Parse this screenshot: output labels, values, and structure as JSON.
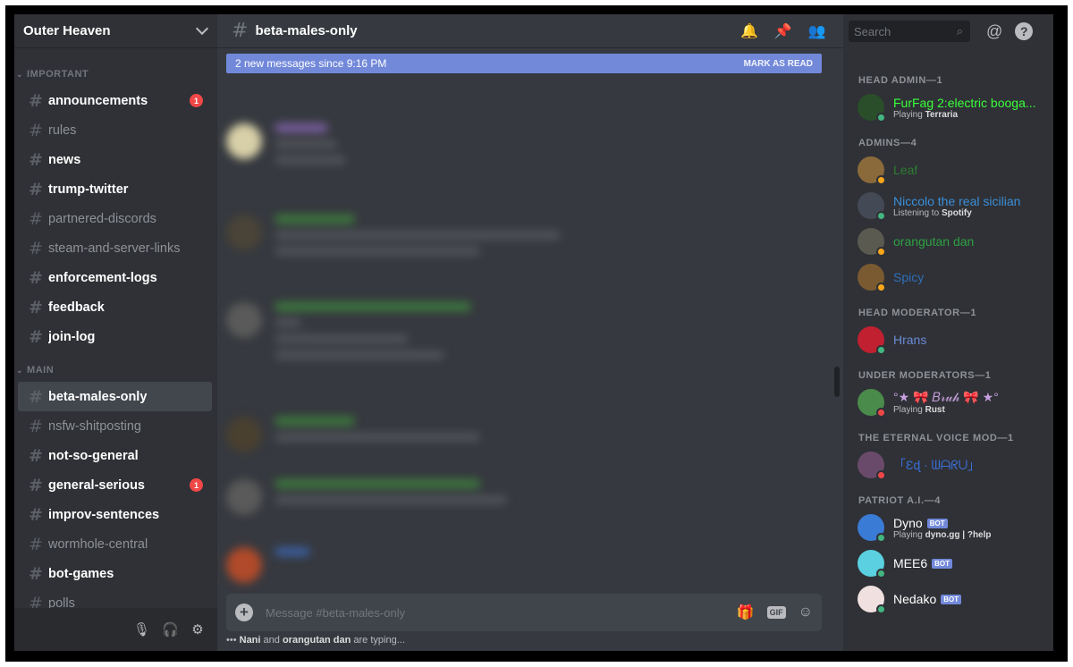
{
  "server": {
    "name": "Outer Heaven"
  },
  "categories": [
    {
      "name": "IMPORTANT",
      "channels": [
        {
          "name": "announcements",
          "state": "unread",
          "badge": "1"
        },
        {
          "name": "rules",
          "state": "muted"
        },
        {
          "name": "news",
          "state": "unread"
        },
        {
          "name": "trump-twitter",
          "state": "unread"
        },
        {
          "name": "partnered-discords",
          "state": "muted"
        },
        {
          "name": "steam-and-server-links",
          "state": "muted"
        },
        {
          "name": "enforcement-logs",
          "state": "unread"
        },
        {
          "name": "feedback",
          "state": "unread"
        },
        {
          "name": "join-log",
          "state": "unread"
        }
      ]
    },
    {
      "name": "MAIN",
      "channels": [
        {
          "name": "beta-males-only",
          "state": "active"
        },
        {
          "name": "nsfw-shitposting",
          "state": "muted"
        },
        {
          "name": "not-so-general",
          "state": "unread"
        },
        {
          "name": "general-serious",
          "state": "unread",
          "badge": "1"
        },
        {
          "name": "improv-sentences",
          "state": "unread"
        },
        {
          "name": "wormhole-central",
          "state": "muted"
        },
        {
          "name": "bot-games",
          "state": "unread"
        },
        {
          "name": "polls",
          "state": "muted"
        }
      ]
    }
  ],
  "channel": {
    "hash": "#",
    "name": "beta-males-only",
    "new_messages": "2 new messages since 9:16 PM",
    "mark_as_read": "MARK AS READ",
    "composer_placeholder": "Message #beta-males-only",
    "gif_label": "GIF",
    "typing": {
      "user1": "Nani",
      "joiner": "and",
      "user2": "orangutan dan",
      "suffix": "are typing..."
    }
  },
  "search": {
    "placeholder": "Search"
  },
  "member_groups": [
    {
      "role": "HEAD ADMIN—1",
      "members": [
        {
          "name": "FurFag 2:electric booga...",
          "color": "#3bff3b",
          "activity_prefix": "Playing",
          "activity": "Terraria",
          "status": "#43b581",
          "avatar": "#2a4d2a"
        }
      ]
    },
    {
      "role": "ADMINS—4",
      "members": [
        {
          "name": "Leaf",
          "color": "#2e7d32",
          "status": "#faa61a",
          "avatar": "#8a6a3a"
        },
        {
          "name": "Niccolo the real sicilian",
          "color": "#3b8fd8",
          "activity_prefix": "Listening to",
          "activity": "Spotify",
          "status": "#43b581",
          "avatar": "#444a55"
        },
        {
          "name": "orangutan dan",
          "color": "#2ea043",
          "status": "#faa61a",
          "avatar": "#5a5a50"
        },
        {
          "name": "Spicy",
          "color": "#2e6fb8",
          "status": "#faa61a",
          "avatar": "#7a5a30"
        }
      ]
    },
    {
      "role": "HEAD MODERATOR—1",
      "members": [
        {
          "name": "Hrans",
          "color": "#6a8ad8",
          "status": "#43b581",
          "avatar": "#c02030"
        }
      ]
    },
    {
      "role": "UNDER MODERATORS—1",
      "members": [
        {
          "name": "°★ 🎀 𝐵𝓇𝓊𝒽 🎀 ★°",
          "color": "#c8a0e0",
          "activity_prefix": "Playing",
          "activity": "Rust",
          "status": "#f04747",
          "avatar": "#4a8a4a"
        }
      ]
    },
    {
      "role": "THE ETERNAL VOICE MOD—1",
      "members": [
        {
          "name": "「Ɛɖ · ᗯᗩᖇᑌ」",
          "color": "#3b6fd8",
          "status": "#f04747",
          "avatar": "#6a4a6a"
        }
      ]
    },
    {
      "role": "PATRIOT A.I.—4",
      "members": [
        {
          "name": "Dyno",
          "color": "#ffffff",
          "bot": "BOT",
          "activity_prefix": "Playing",
          "activity": "dyno.gg | ?help",
          "status": "#43b581",
          "avatar": "#3a7bd5"
        },
        {
          "name": "MEE6",
          "color": "#ffffff",
          "bot": "BOT",
          "status": "#43b581",
          "avatar": "#5ad0e0"
        },
        {
          "name": "Nedako",
          "color": "#ffffff",
          "bot": "BOT",
          "status": "#43b581",
          "avatar": "#f0e0e0"
        }
      ]
    }
  ],
  "colors": {
    "sidebar": "#2f3136",
    "chat": "#36393f",
    "accent": "#7289da",
    "badge": "#f04747"
  }
}
